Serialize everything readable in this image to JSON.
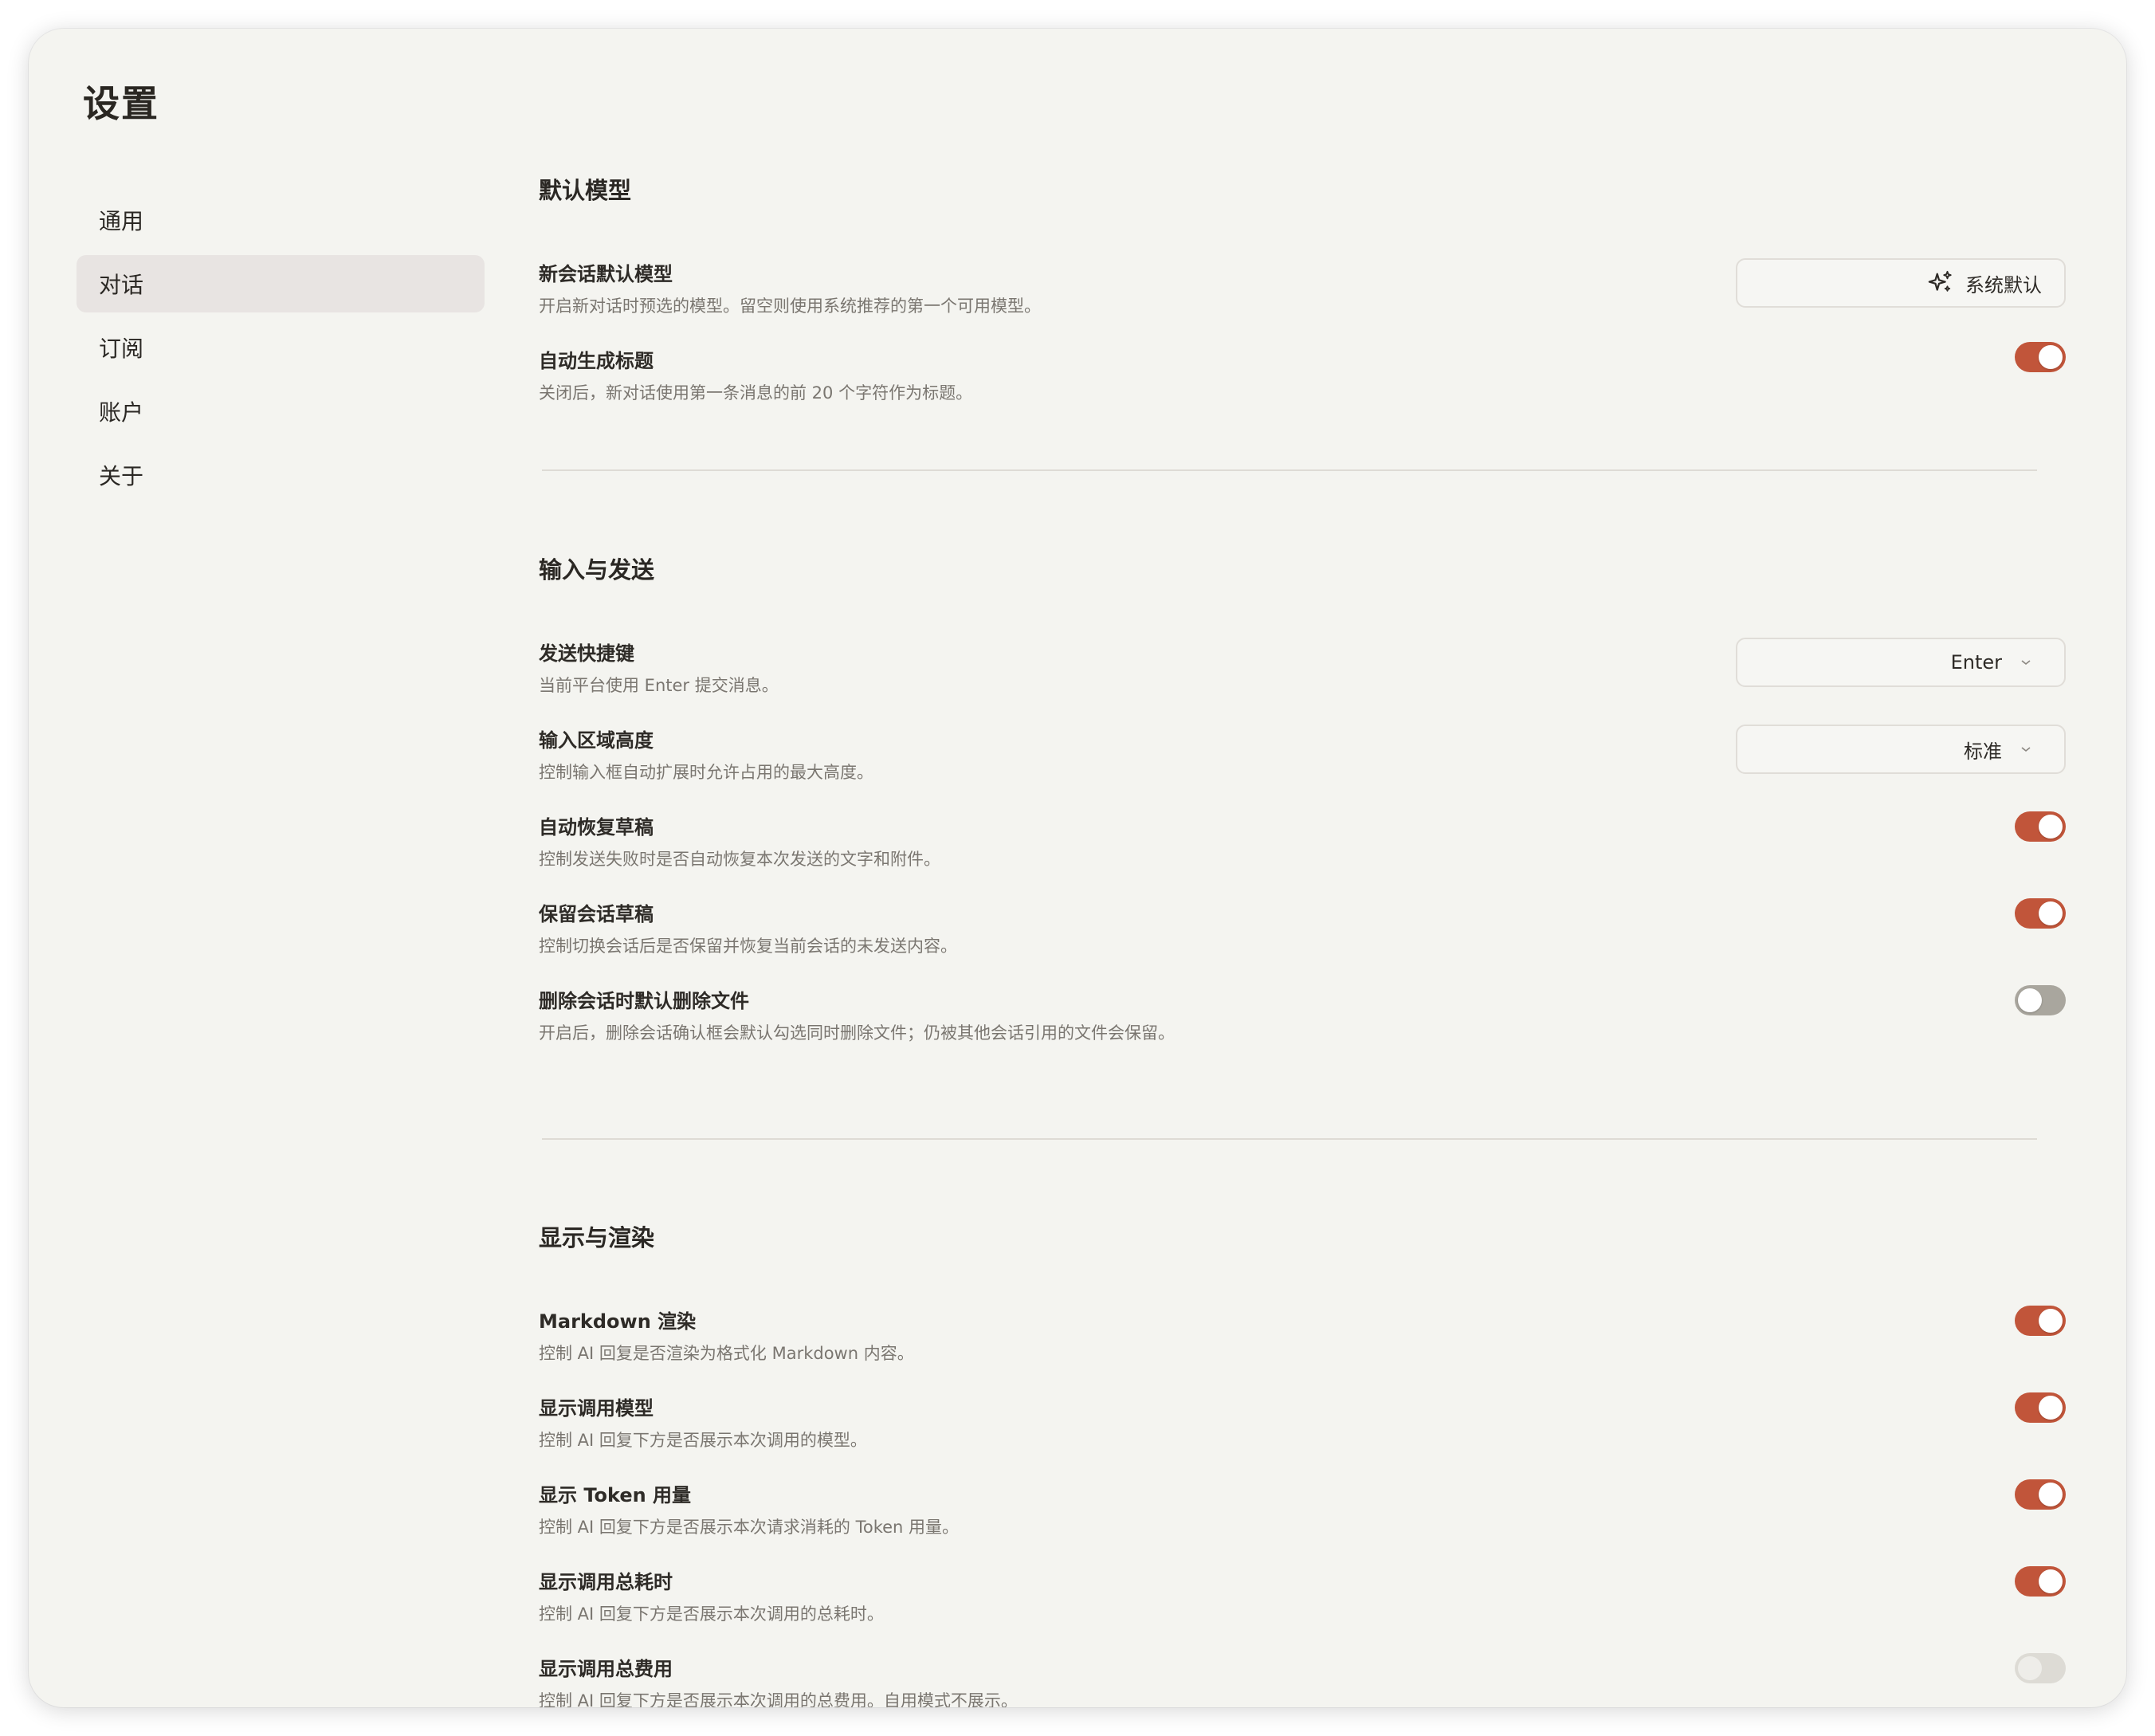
{
  "page_title": "设置",
  "sidebar": {
    "items": [
      {
        "label": "通用",
        "active": false
      },
      {
        "label": "对话",
        "active": true
      },
      {
        "label": "订阅",
        "active": false
      },
      {
        "label": "账户",
        "active": false
      },
      {
        "label": "关于",
        "active": false
      }
    ]
  },
  "sections": {
    "default_model": {
      "title": "默认模型",
      "new_chat_model": {
        "title": "新会话默认模型",
        "desc": "开启新对话时预选的模型。留空则使用系统推荐的第一个可用模型。",
        "value": "系统默认",
        "icon": "sparkle-icon"
      },
      "auto_title": {
        "title": "自动生成标题",
        "desc": "关闭后，新对话使用第一条消息的前 20 个字符作为标题。",
        "enabled": true
      }
    },
    "input_send": {
      "title": "输入与发送",
      "send_shortcut": {
        "title": "发送快捷键",
        "desc": "当前平台使用 Enter 提交消息。",
        "value": "Enter"
      },
      "input_height": {
        "title": "输入区域高度",
        "desc": "控制输入框自动扩展时允许占用的最大高度。",
        "value": "标准"
      },
      "auto_restore_draft": {
        "title": "自动恢复草稿",
        "desc": "控制发送失败时是否自动恢复本次发送的文字和附件。",
        "enabled": true
      },
      "keep_chat_draft": {
        "title": "保留会话草稿",
        "desc": "控制切换会话后是否保留并恢复当前会话的未发送内容。",
        "enabled": true
      },
      "delete_files": {
        "title": "删除会话时默认删除文件",
        "desc": "开启后，删除会话确认框会默认勾选同时删除文件；仍被其他会话引用的文件会保留。",
        "enabled": false
      }
    },
    "display_render": {
      "title": "显示与渲染",
      "markdown": {
        "title": "Markdown 渲染",
        "desc": "控制 AI 回复是否渲染为格式化 Markdown 内容。",
        "enabled": true
      },
      "show_model": {
        "title": "显示调用模型",
        "desc": "控制 AI 回复下方是否展示本次调用的模型。",
        "enabled": true
      },
      "show_tokens": {
        "title": "显示 Token 用量",
        "desc": "控制 AI 回复下方是否展示本次请求消耗的 Token 用量。",
        "enabled": true
      },
      "show_duration": {
        "title": "显示调用总耗时",
        "desc": "控制 AI 回复下方是否展示本次调用的总耗时。",
        "enabled": true
      },
      "show_cost": {
        "title": "显示调用总费用",
        "desc": "控制 AI 回复下方是否展示本次调用的总费用。自用模式不展示。",
        "enabled": false,
        "disabled": true
      }
    }
  },
  "colors": {
    "accent": "#c1553a",
    "background": "#f4f4f0",
    "sidebar_active": "#e8e4e2"
  }
}
